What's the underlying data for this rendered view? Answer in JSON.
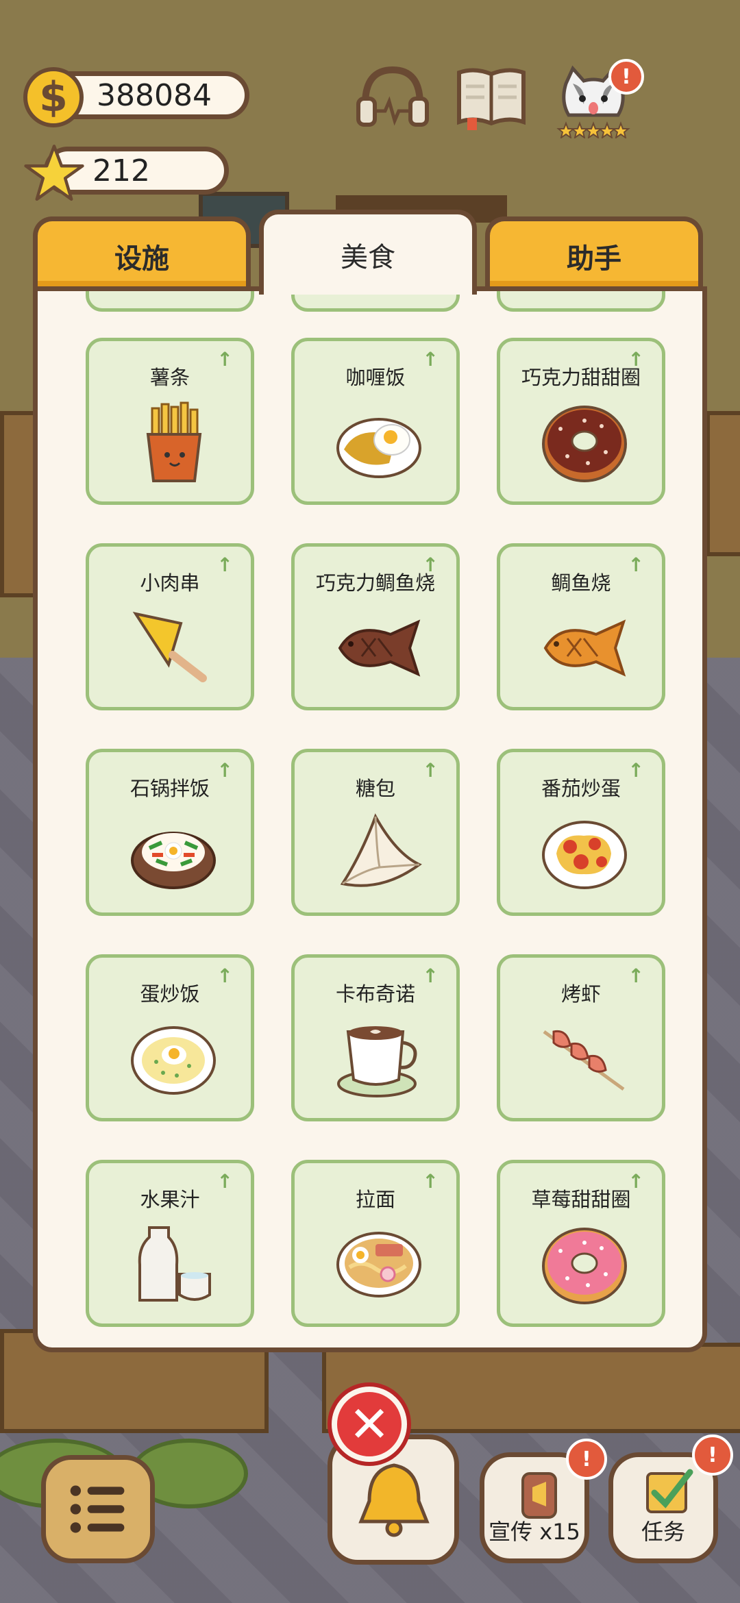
{
  "hud": {
    "coins": "388084",
    "stars": "212"
  },
  "tabs": [
    {
      "label": "设施",
      "active": false
    },
    {
      "label": "美食",
      "active": true
    },
    {
      "label": "助手",
      "active": false
    }
  ],
  "foods": [
    {
      "name": "薯条",
      "icon": "fries-icon"
    },
    {
      "name": "咖喱饭",
      "icon": "curry-rice-icon"
    },
    {
      "name": "巧克力甜甜圈",
      "icon": "chocolate-donut-icon"
    },
    {
      "name": "小肉串",
      "icon": "skewer-icon"
    },
    {
      "name": "巧克力鲷鱼烧",
      "icon": "chocolate-taiyaki-icon"
    },
    {
      "name": "鲷鱼烧",
      "icon": "taiyaki-icon"
    },
    {
      "name": "石锅拌饭",
      "icon": "bibimbap-icon"
    },
    {
      "name": "糖包",
      "icon": "sugar-bun-icon"
    },
    {
      "name": "番茄炒蛋",
      "icon": "tomato-egg-icon"
    },
    {
      "name": "蛋炒饭",
      "icon": "fried-rice-icon"
    },
    {
      "name": "卡布奇诺",
      "icon": "cappuccino-icon"
    },
    {
      "name": "烤虾",
      "icon": "grilled-shrimp-icon"
    },
    {
      "name": "水果汁",
      "icon": "fruit-juice-icon"
    },
    {
      "name": "拉面",
      "icon": "ramen-icon"
    },
    {
      "name": "草莓甜甜圈",
      "icon": "strawberry-donut-icon"
    }
  ],
  "upgrade_symbol": "↑",
  "bottom_bar": {
    "close_symbol": "✕",
    "promo_label": "宣传 x15",
    "tasks_label": "任务",
    "badge_symbol": "!"
  },
  "colors": {
    "tab_inactive": "#f6b733",
    "panel_bg": "#fbf5ec",
    "card_bg": "#e8f0d6",
    "card_border": "#9cc07a",
    "close_red": "#e23b3b"
  }
}
